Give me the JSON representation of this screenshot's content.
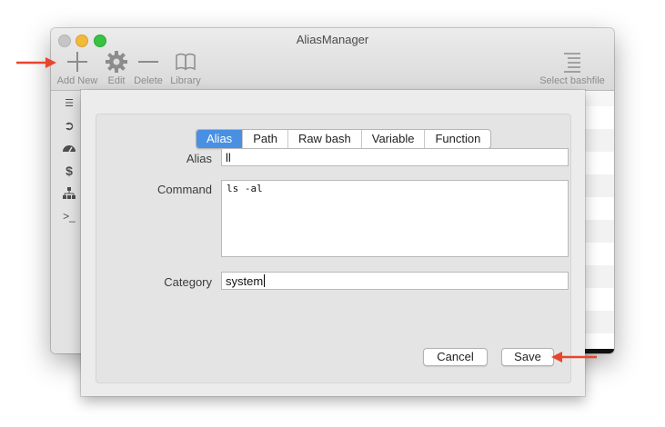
{
  "window": {
    "title": "AliasManager"
  },
  "toolbar": {
    "add_new_label": "Add New",
    "edit_label": "Edit",
    "delete_label": "Delete",
    "library_label": "Library",
    "select_bashfile_label": "Select bashfile"
  },
  "sidebar": {
    "icons": [
      "list-icon",
      "circle-arrow-icon",
      "dashboard-icon",
      "dollar-icon",
      "hierarchy-icon",
      "terminal-icon"
    ]
  },
  "sheet": {
    "tabs": [
      {
        "label": "Alias",
        "active": true
      },
      {
        "label": "Path",
        "active": false
      },
      {
        "label": "Raw bash",
        "active": false
      },
      {
        "label": "Variable",
        "active": false
      },
      {
        "label": "Function",
        "active": false
      }
    ],
    "alias_label": "Alias",
    "alias_value": "ll",
    "command_label": "Command",
    "command_value": "ls -al",
    "category_label": "Category",
    "category_value": "system",
    "cancel_label": "Cancel",
    "save_label": "Save"
  },
  "colors": {
    "accent": "#4a90e2",
    "annotation_arrow": "#e8452c"
  }
}
